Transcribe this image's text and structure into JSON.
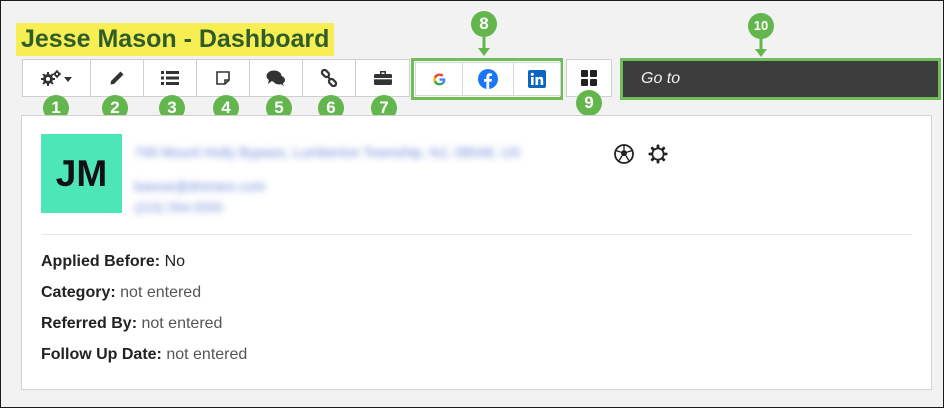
{
  "header": {
    "title": "Jesse Mason - Dashboard"
  },
  "toolbar": {
    "buttons": [
      {
        "name": "settings-dropdown",
        "icon": "gears-caret-icon"
      },
      {
        "name": "edit",
        "icon": "pencil-icon"
      },
      {
        "name": "list",
        "icon": "list-icon"
      },
      {
        "name": "note",
        "icon": "note-icon"
      },
      {
        "name": "comments",
        "icon": "chat-bubbles-icon"
      },
      {
        "name": "link",
        "icon": "chain-link-icon"
      },
      {
        "name": "briefcase",
        "icon": "briefcase-icon"
      }
    ],
    "social": [
      {
        "name": "google",
        "icon": "google-icon",
        "color": "#4285f4"
      },
      {
        "name": "facebook",
        "icon": "facebook-icon",
        "color": "#1877f2"
      },
      {
        "name": "linkedin",
        "icon": "linkedin-icon",
        "color": "#0a66c2"
      }
    ],
    "apps": {
      "icon": "grid-icon"
    },
    "goto_label": "Go to"
  },
  "callouts": [
    "1",
    "2",
    "3",
    "4",
    "5",
    "6",
    "7",
    "8",
    "9",
    "10"
  ],
  "profile": {
    "initials": "JM",
    "avatar_color": "#4de6b6",
    "address": "749 Mount Holly Bypass, Lumberton Township, NJ, 08048, US",
    "email": "lsavoe@dnmars.com",
    "phone": "(215) 554-5555",
    "icons": [
      "soccer-ball-icon",
      "gear-icon"
    ]
  },
  "fields": [
    {
      "label": "Applied Before:",
      "value": "No"
    },
    {
      "label": "Category:",
      "value": "not entered"
    },
    {
      "label": "Referred By:",
      "value": "not entered"
    },
    {
      "label": "Follow Up Date:",
      "value": "not entered"
    }
  ],
  "colors": {
    "accent": "#63b64d",
    "highlight": "#f6ee52",
    "title": "#2f5d2a",
    "goto_bg": "#3c3c3c"
  }
}
